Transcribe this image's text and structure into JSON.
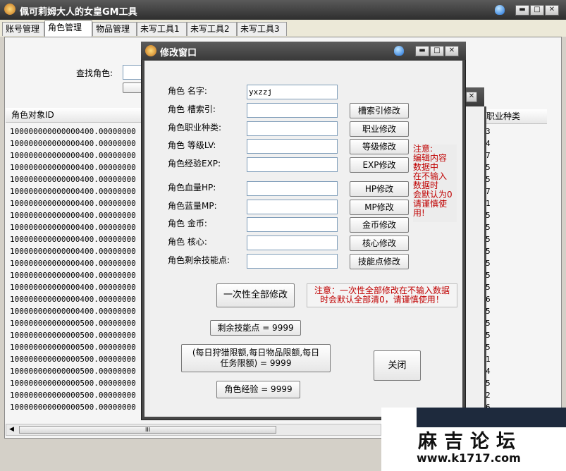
{
  "app": {
    "title": "佩可莉姆大人的女皇GM工具"
  },
  "window_controls": {
    "minimize": "▬",
    "maximize": "□",
    "close": "✕"
  },
  "tabs": [
    {
      "label": "账号管理"
    },
    {
      "label": "角色管理"
    },
    {
      "label": "物品管理"
    },
    {
      "label": "未写工具1"
    },
    {
      "label": "未写工具2"
    },
    {
      "label": "未写工具3"
    }
  ],
  "search": {
    "label": "查找角色:",
    "value": ""
  },
  "list": {
    "col_id": "角色对象ID",
    "col_job": "职业种类",
    "ids": [
      "100000000000000400.00000000",
      "100000000000000400.00000000",
      "100000000000000400.00000000",
      "100000000000000400.00000000",
      "100000000000000400.00000000",
      "100000000000000400.00000000",
      "100000000000000400.00000000",
      "100000000000000400.00000000",
      "100000000000000400.00000000",
      "100000000000000400.00000000",
      "100000000000000400.00000000",
      "100000000000000400.00000000",
      "100000000000000400.00000000",
      "100000000000000400.00000000",
      "100000000000000400.00000000",
      "100000000000000400.00000000",
      "100000000000000500.00000000",
      "100000000000000500.00000000",
      "100000000000000500.00000000",
      "100000000000000500.00000000",
      "100000000000000500.00000000",
      "100000000000000500.00000000",
      "100000000000000500.00000000",
      "100000000000000500.00000000"
    ],
    "jobs": [
      "3",
      "4",
      "7",
      "5",
      "5",
      "7",
      "1",
      "5",
      "5",
      "5",
      "5",
      "5",
      "5",
      "5",
      "6",
      "5",
      "5",
      "5",
      "5",
      "1",
      "4",
      "5",
      "2",
      "6"
    ],
    "scroll_grip": "III"
  },
  "dialog": {
    "title": "修改窗口",
    "fields": [
      {
        "label": "角色    名字:",
        "value": "yxzzj"
      },
      {
        "label": "角色 槽索引:",
        "value": ""
      },
      {
        "label": "角色职业种类:",
        "value": ""
      },
      {
        "label": "角色 等级LV:",
        "value": ""
      },
      {
        "label": "角色经验EXP:",
        "value": ""
      },
      {
        "label": "角色血量HP:",
        "value": ""
      },
      {
        "label": "角色蓝量MP:",
        "value": ""
      },
      {
        "label": "角色    金币:",
        "value": ""
      },
      {
        "label": "角色    核心:",
        "value": ""
      },
      {
        "label": "角色剩余技能点:",
        "value": ""
      }
    ],
    "buttons": [
      "槽索引修改",
      "职业修改",
      "等级修改",
      "EXP修改",
      "HP修改",
      "MP修改",
      "金币修改",
      "核心修改",
      "技能点修改"
    ],
    "note_side": [
      "注意:",
      "编辑内容",
      "数据中",
      "在不输入",
      "数据时",
      "会默认为0",
      "请谨慎使",
      "用!"
    ],
    "apply_all": "一次性全部修改",
    "note_bottom": [
      "注意：一次性全部修改在不输入数据",
      "时会默认全部清0，请谨慎使用！"
    ],
    "skill_points_btn": "剩余技能点 = 9999",
    "daily_limit_btn": [
      "(每日狩猎限额,每日物品限额,每日",
      "任务限额) = 9999"
    ],
    "close_btn": "关闭",
    "exp_btn": "角色经验 = 9999"
  },
  "watermark": {
    "site_name": "麻吉论坛",
    "url": "www.k1717.com"
  },
  "colors": {
    "titlebar": "#3a3a3a",
    "warning": "#c00000"
  }
}
